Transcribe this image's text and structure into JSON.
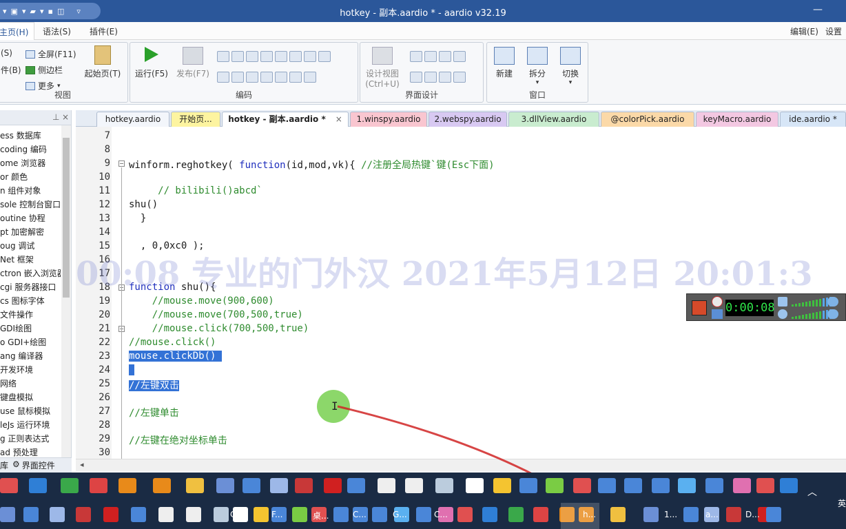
{
  "window": {
    "title": "hotkey - 副本.aardio * - aardio v32.19",
    "qat_more": "▿"
  },
  "menu": {
    "tabs": [
      "主页(H)",
      "语法(S)",
      "插件(E)"
    ],
    "right": [
      "编辑(E)",
      "设置"
    ]
  },
  "ribbon": {
    "view_group": {
      "label": "视图",
      "items": [
        "(S)",
        "件(B)",
        "全屏(F11)",
        "侧边栏",
        "更多"
      ]
    },
    "start_page": "起始页(T)",
    "run": "运行(F5)",
    "publish": "发布(F7)",
    "edit_group": "编码",
    "design_view": {
      "line1": "设计视图",
      "line2": "(Ctrl+U)"
    },
    "ui_group": "界面设计",
    "window_group": {
      "label": "窗口",
      "new": "新建",
      "split": "拆分",
      "switch": "切换"
    }
  },
  "sidebar": {
    "pin": "⊥",
    "items": [
      "ess 数据库",
      "coding 编码",
      "ome 浏览器",
      "or 颜色",
      "n 组件对象",
      "sole 控制台窗口",
      "outine 协程",
      "pt 加密解密",
      "oug 调试",
      "Net 框架",
      "ctron 嵌入浏览器",
      "cgi 服务器接口",
      "cs 图标字体",
      "文件操作",
      "GDI绘图",
      "o GDI+绘图",
      "ang 编译器",
      "开发环境",
      "网络",
      "键盘模拟",
      "use 鼠标模拟",
      "leJs 运行环境",
      "g 正则表达式",
      "ad 预处理"
    ],
    "bottom_tabs": [
      "库",
      "界面控件"
    ]
  },
  "tabs": [
    {
      "label": "hotkey.aardio",
      "color": "#f3f6fb"
    },
    {
      "label": "开始页...",
      "color": "#fdf4a0"
    },
    {
      "label": "hotkey - 副本.aardio *",
      "color": "#ffffff",
      "close": "×"
    },
    {
      "label": "1.winspy.aardio",
      "color": "#f9c6d0"
    },
    {
      "label": "2.webspy.aardio",
      "color": "#d8c9f2"
    },
    {
      "label": "3.dllView.aardio",
      "color": "#c9eccf"
    },
    {
      "label": "@colorPick.aardio",
      "color": "#fbd9a8"
    },
    {
      "label": "keyMacro.aardio",
      "color": "#f3c8e2"
    },
    {
      "label": "ide.aardio *",
      "color": "#d7e6f7"
    }
  ],
  "code": {
    "line_numbers": [
      "7",
      "8",
      "9",
      "10",
      "11",
      "12",
      "13",
      "14",
      "15",
      "16",
      "17",
      "18",
      "19",
      "20",
      "21",
      "22",
      "23",
      "24",
      "25",
      "26",
      "27",
      "28",
      "29",
      "30"
    ],
    "lines": [
      {
        "text": ""
      },
      {
        "text": ""
      },
      {
        "pre": "winform.reghotkey( ",
        "kw": "function",
        "post": "(id,mod,vk){ ",
        "cm": "//注册全局热键`键(Esc下面)"
      },
      {
        "text": ""
      },
      {
        "cm": "     // bilibili()abcd`"
      },
      {
        "text": "shu()"
      },
      {
        "text": "  }"
      },
      {
        "text": ""
      },
      {
        "text": "  , 0,0xc0 );"
      },
      {
        "text": ""
      },
      {
        "text": ""
      },
      {
        "kw": "function",
        "post": " shu(){"
      },
      {
        "cm": "    //mouse.move(900,600)"
      },
      {
        "cm": "    //mouse.move(700,500,true)"
      },
      {
        "cm": "    //mouse.click(700,500,true)"
      },
      {
        "cm": "//mouse.click()"
      },
      {
        "sel": "mouse.clickDb() "
      },
      {
        "sel": " "
      },
      {
        "sel": "//左键双击"
      },
      {
        "text": ""
      },
      {
        "cm": "//左键单击"
      },
      {
        "text": ""
      },
      {
        "cm": "//左键在绝对坐标单击"
      },
      {
        "text": ""
      }
    ]
  },
  "overlay": {
    "watermark": "00:08  专业的门外汉  2021年5月12日 20:01:3",
    "timer": "0:00:08"
  },
  "taskbar": {
    "row1_labels": [],
    "row2_labels": [
      "C...",
      "F...",
      "桌...",
      "C...",
      "G...",
      "C...",
      "h...",
      "1...",
      "a...",
      "D..."
    ],
    "ime": "英"
  },
  "colors": {
    "title": "#2b579a",
    "taskbar": "#1a2b44",
    "selection": "#3372d6",
    "comment": "#2e8b2e",
    "keyword": "#1f2fbd"
  }
}
